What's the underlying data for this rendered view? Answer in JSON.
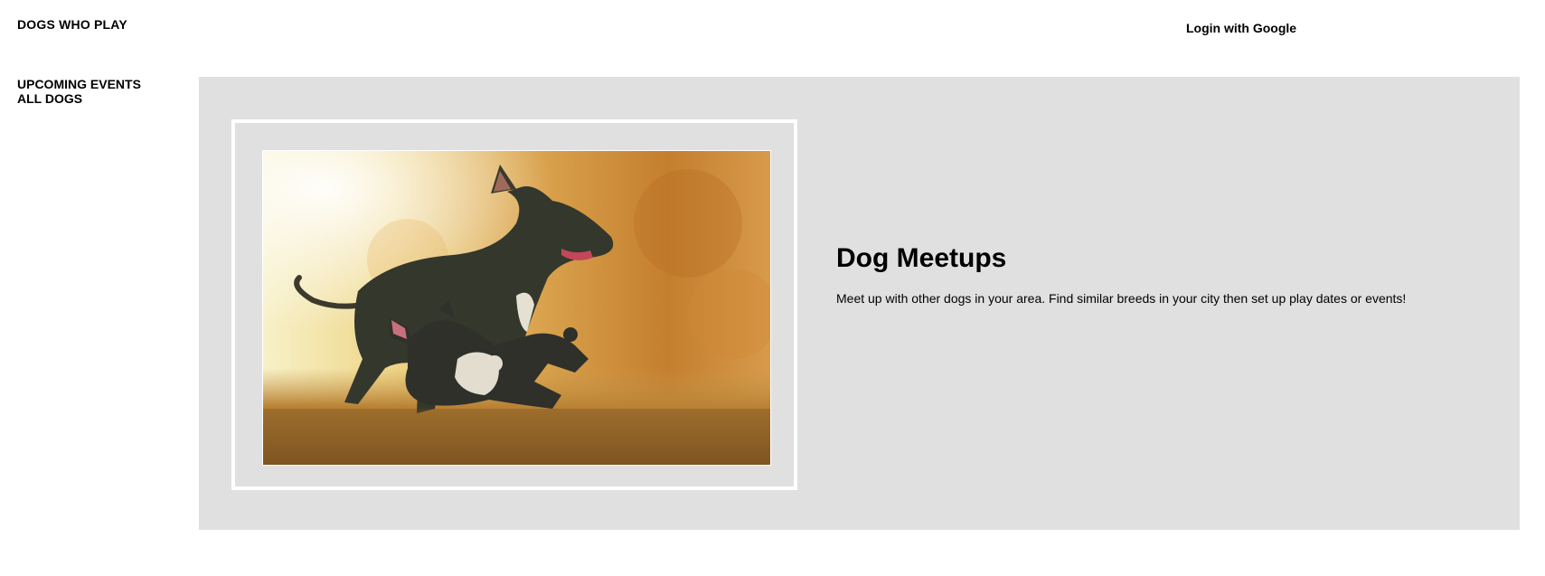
{
  "header": {
    "brand": "DOGS WHO PLAY",
    "login_label": "Login with Google"
  },
  "sidebar": {
    "items": [
      {
        "label": "UPCOMING EVENTS"
      },
      {
        "label": "ALL DOGS"
      }
    ]
  },
  "hero": {
    "title": "Dog Meetups",
    "description": "Meet up with other dogs in your area. Find similar breeds in your city then set up play dates or events!",
    "image_subject": "two dogs playing"
  },
  "colors": {
    "hero_bg": "#e0e0e0",
    "frame_border": "#ffffff"
  }
}
